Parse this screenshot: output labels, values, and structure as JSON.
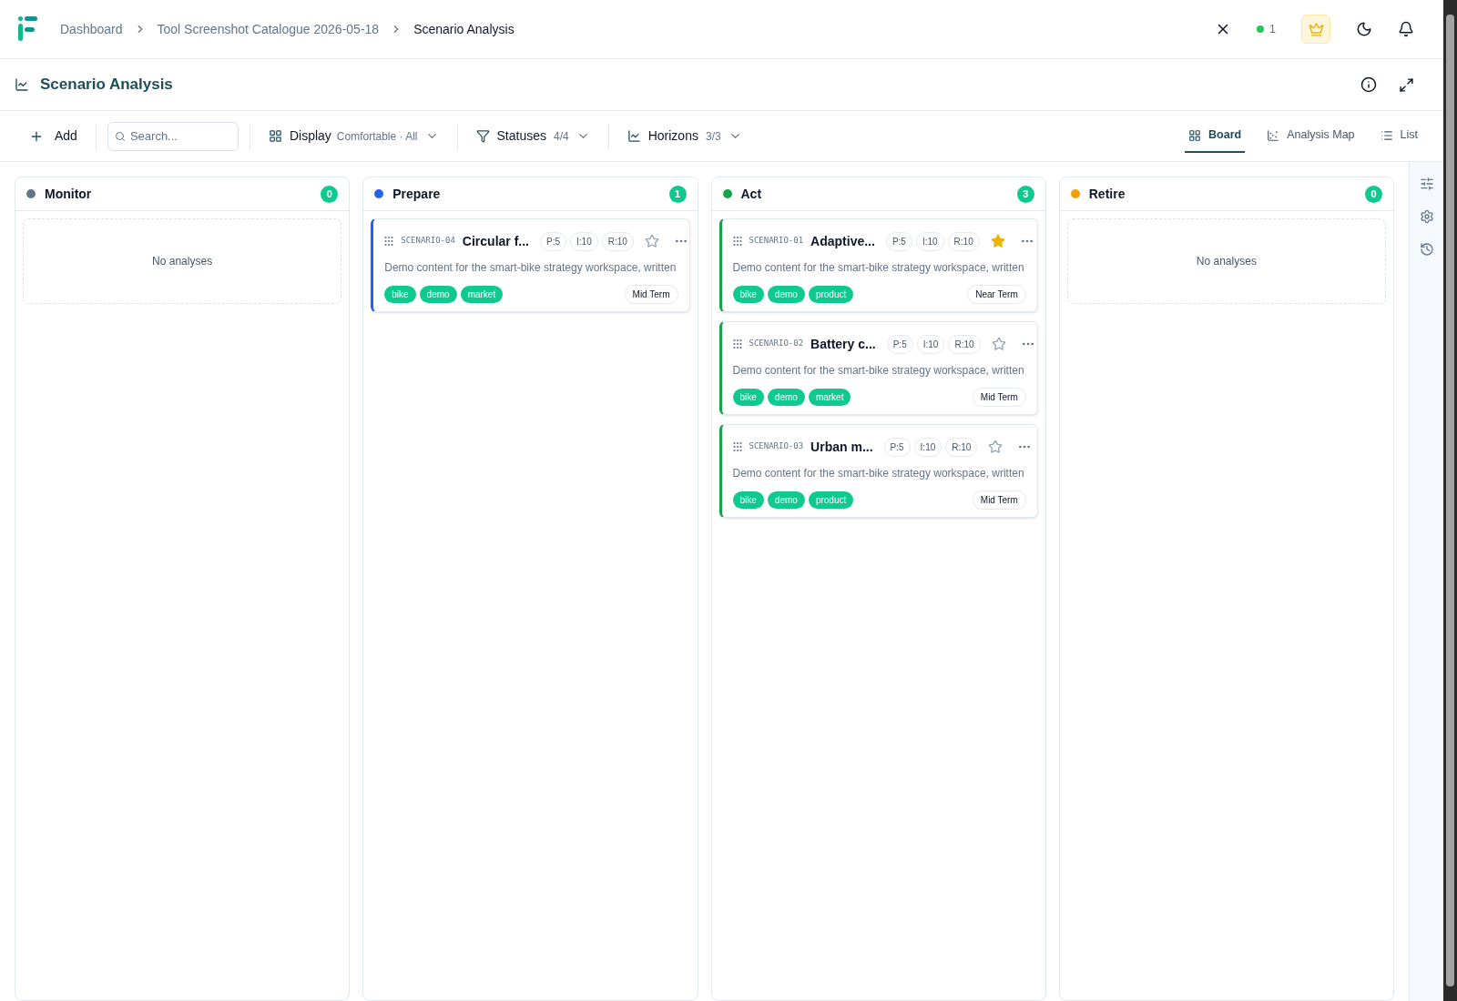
{
  "breadcrumbs": [
    {
      "label": "Dashboard",
      "current": false
    },
    {
      "label": "Tool Screenshot Catalogue 2026-05-18",
      "current": false
    },
    {
      "label": "Scenario Analysis",
      "current": true
    }
  ],
  "header": {
    "online_count": "1"
  },
  "page_title": "Scenario Analysis",
  "toolbar": {
    "add": "Add",
    "search": {
      "placeholder": "Search..."
    },
    "display": {
      "label": "Display",
      "value": "Comfortable · All"
    },
    "statuses": {
      "label": "Statuses",
      "value": "4/4"
    },
    "horizons": {
      "label": "Horizons",
      "value": "3/3"
    }
  },
  "views": [
    {
      "label": "Board",
      "selected": true,
      "kind": "board"
    },
    {
      "label": "Analysis Map",
      "selected": false,
      "kind": "map"
    },
    {
      "label": "List",
      "selected": false,
      "kind": "list"
    }
  ],
  "columns": [
    {
      "name": "Monitor",
      "color": "#64748b",
      "count": "0",
      "empty_text": "No analyses"
    },
    {
      "name": "Prepare",
      "color": "#2563eb",
      "count": "1",
      "cards": [
        {
          "id": "SCENARIO-04",
          "title": "Circular f...",
          "scores": [
            "P:5",
            "I:10",
            "R:10"
          ],
          "starred": false,
          "description": "Demo content for the smart-bike strategy workspace, written",
          "tags": [
            "bike",
            "demo",
            "market"
          ],
          "horizon": "Mid Term"
        }
      ]
    },
    {
      "name": "Act",
      "color": "#16a34a",
      "count": "3",
      "cards": [
        {
          "id": "SCENARIO-01",
          "title": "Adaptive...",
          "scores": [
            "P:5",
            "I:10",
            "R:10"
          ],
          "starred": true,
          "description": "Demo content for the smart-bike strategy workspace, written",
          "tags": [
            "bike",
            "demo",
            "product"
          ],
          "horizon": "Near Term"
        },
        {
          "id": "SCENARIO-02",
          "title": "Battery c...",
          "scores": [
            "P:5",
            "I:10",
            "R:10"
          ],
          "starred": false,
          "description": "Demo content for the smart-bike strategy workspace, written",
          "tags": [
            "bike",
            "demo",
            "market"
          ],
          "horizon": "Mid Term"
        },
        {
          "id": "SCENARIO-03",
          "title": "Urban m...",
          "scores": [
            "P:5",
            "I:10",
            "R:10"
          ],
          "starred": false,
          "description": "Demo content for the smart-bike strategy workspace, written",
          "tags": [
            "bike",
            "demo",
            "product"
          ],
          "horizon": "Mid Term"
        }
      ]
    },
    {
      "name": "Retire",
      "color": "#f59e0b",
      "count": "0",
      "empty_text": "No analyses"
    }
  ]
}
